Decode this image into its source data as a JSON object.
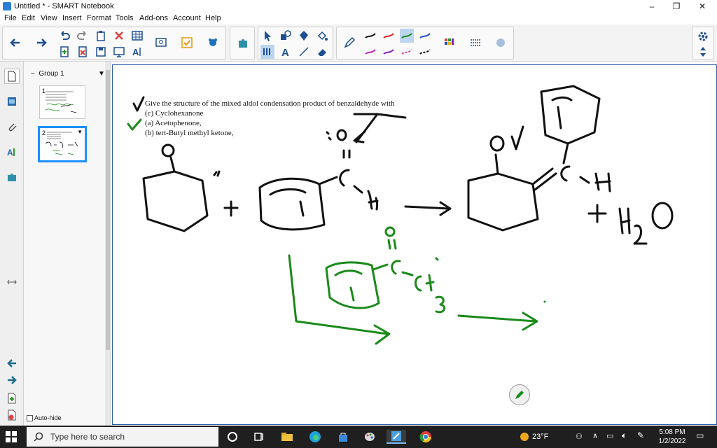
{
  "window": {
    "title": "Untitled * - SMART Notebook",
    "minimize": "–",
    "restore": "❐",
    "close": "✕"
  },
  "menu": [
    "File",
    "Edit",
    "View",
    "Insert",
    "Format",
    "Tools",
    "Add-ons",
    "Account",
    "Help"
  ],
  "sorter": {
    "group_label": "Group 1",
    "pages": [
      "1",
      "2"
    ],
    "autohide_label": "Auto-hide"
  },
  "canvas": {
    "question_lines": [
      "Give the structure of the mixed aldol condensation product of benzaldehyde with",
      "(c) Cyclohexanone",
      "(a) Acetophenone,",
      "(b) tert-Butyl methyl ketone,"
    ],
    "colors": {
      "ink": "#111111",
      "green_ink": "#1a8a1a"
    }
  },
  "taskbar": {
    "search_placeholder": "Type here to search",
    "temperature": "23°F",
    "time": "5:08 PM",
    "date": "1/2/2022"
  },
  "colors": {
    "accent": "#2a7fd4",
    "taskbar": "#1f1f1f",
    "selected_thumb": "#1e90ff"
  }
}
